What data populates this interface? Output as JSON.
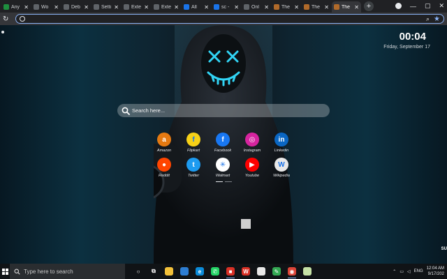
{
  "tabs": [
    {
      "label": "Any",
      "icon": "sheets-icon",
      "color": "#1e8e3e"
    },
    {
      "label": "Wo",
      "icon": "w-icon",
      "color": "#5f6368"
    },
    {
      "label": "Deb",
      "icon": "globe-icon",
      "color": "#5f6368"
    },
    {
      "label": "Setti",
      "icon": "gear-icon",
      "color": "#5f6368"
    },
    {
      "label": "Exte",
      "icon": "puzzle-icon",
      "color": "#5f6368"
    },
    {
      "label": "Exte",
      "icon": "puzzle-icon",
      "color": "#5f6368"
    },
    {
      "label": "All",
      "icon": "c-icon",
      "color": "#1a73e8"
    },
    {
      "label": "sc -",
      "icon": "c-icon",
      "color": "#1a73e8"
    },
    {
      "label": "Onl",
      "icon": "globe-icon",
      "color": "#5f6368"
    },
    {
      "label": "The",
      "icon": "hood-icon",
      "color": "#b06a2a"
    },
    {
      "label": "The",
      "icon": "hood-icon",
      "color": "#b06a2a"
    },
    {
      "label": "The",
      "icon": "hood-icon",
      "color": "#b06a2a",
      "active": true
    }
  ],
  "omnibox": {
    "value": "",
    "placeholder": ""
  },
  "clock": {
    "time": "00:04",
    "date": "Friday, September 17"
  },
  "search": {
    "placeholder": "Search here..."
  },
  "shortcuts": [
    {
      "label": "Amazon",
      "icon": "amazon-icon",
      "color": "#e47911",
      "glyph": "a"
    },
    {
      "label": "Flipkart",
      "icon": "flipkart-icon",
      "color": "#f7d117",
      "glyph": "f"
    },
    {
      "label": "Facebook",
      "icon": "facebook-icon",
      "color": "#1877f2",
      "glyph": "f"
    },
    {
      "label": "Instagram",
      "icon": "instagram-icon",
      "color": "#d6249f",
      "glyph": "◎"
    },
    {
      "label": "Linkedin",
      "icon": "linkedin-icon",
      "color": "#0a66c2",
      "glyph": "in"
    },
    {
      "label": "Reddit",
      "icon": "reddit-icon",
      "color": "#ff4500",
      "glyph": "●"
    },
    {
      "label": "Twitter",
      "icon": "twitter-icon",
      "color": "#1d9bf0",
      "glyph": "t"
    },
    {
      "label": "Walmart",
      "icon": "walmart-icon",
      "color": "#ffffff",
      "glyph": "✳"
    },
    {
      "label": "Youtube",
      "icon": "youtube-icon",
      "color": "#ff0000",
      "glyph": "▶"
    },
    {
      "label": "Wikipedia",
      "icon": "wikipedia-icon",
      "color": "#e8e8e8",
      "glyph": "W"
    }
  ],
  "corner_text": "SU",
  "taskbar": {
    "search_placeholder": "Type here to search",
    "apps": [
      {
        "name": "task-view-icon",
        "glyph": "○",
        "color": "transparent"
      },
      {
        "name": "timeline-icon",
        "glyph": "⧉",
        "color": "transparent"
      },
      {
        "name": "file-explorer-icon",
        "glyph": "",
        "color": "#f3c13a"
      },
      {
        "name": "photos-icon",
        "glyph": "",
        "color": "#2d7dd2"
      },
      {
        "name": "edge-icon",
        "glyph": "e",
        "color": "#0b8bd9"
      },
      {
        "name": "whatsapp-icon",
        "glyph": "✆",
        "color": "#25d366"
      },
      {
        "name": "screen-recorder-icon",
        "glyph": "■",
        "color": "#d93025",
        "running": true
      },
      {
        "name": "wps-icon",
        "glyph": "W",
        "color": "#d93025"
      },
      {
        "name": "notes-icon",
        "glyph": "",
        "color": "#e8e8e8"
      },
      {
        "name": "pencil-icon",
        "glyph": "✎",
        "color": "#34a853"
      },
      {
        "name": "chrome-icon",
        "glyph": "◉",
        "color": "#db4437",
        "running": true
      },
      {
        "name": "sheets-icon",
        "glyph": "",
        "color": "#c5e1a5"
      }
    ],
    "language": "ENG",
    "time": "12:04 AM",
    "date": "9/17/202"
  }
}
